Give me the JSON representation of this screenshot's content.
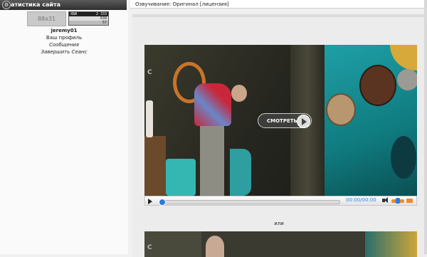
{
  "sidebar": {
    "stats_title": "атистика сайта",
    "counters": {
      "gray_label": "88x31",
      "table": {
        "rows": [
          {
            "label": "ХБИ",
            "value": "2 333"
          },
          {
            "label": "",
            "value": "639"
          },
          {
            "label": "",
            "value": "57"
          }
        ]
      }
    },
    "user": {
      "username": "jeremy01",
      "links": [
        "Ваш профиль",
        "Сообщения",
        "Завершить Сеанс"
      ]
    }
  },
  "main": {
    "dub_text": "Озвучивание: Оригинал [лицензия]",
    "player": {
      "watch_label": "СМОТРЕТЬ",
      "time": "00:00/00:00",
      "progress": 0,
      "volume": 0.5
    },
    "or_text": "или",
    "watermark": "С"
  },
  "colors": {
    "accent": "#2a7be0",
    "volume": "#f08a2a",
    "header_bg": "#3a3a3a"
  }
}
